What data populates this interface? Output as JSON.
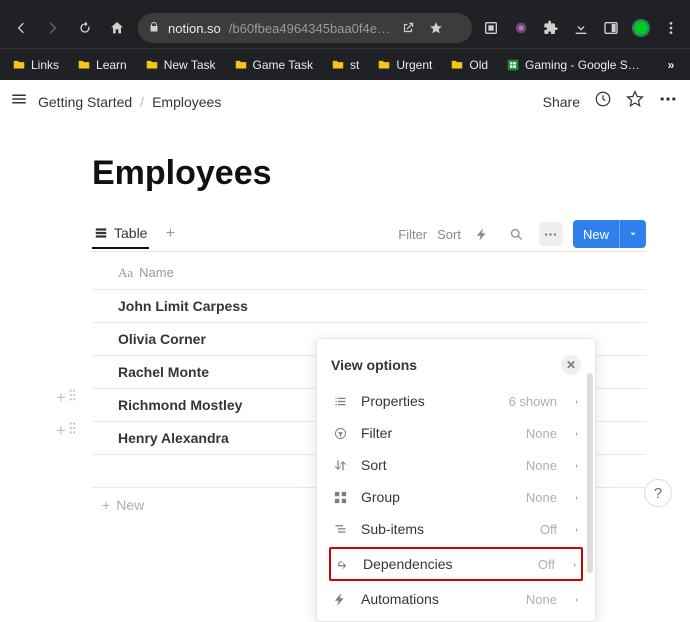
{
  "browser": {
    "url_domain": "notion.so",
    "url_path": "/b60fbea4964345baa0f4e…",
    "bookmarks": [
      "Links",
      "Learn",
      "New Task",
      "Game Task",
      "st",
      "Urgent",
      "Old"
    ],
    "bookmark_sheets": "Gaming - Google S…"
  },
  "topbar": {
    "breadcrumb_parent": "Getting Started",
    "breadcrumb_current": "Employees",
    "share": "Share"
  },
  "page": {
    "title": "Employees"
  },
  "views": {
    "tab_label": "Table",
    "filter": "Filter",
    "sort": "Sort",
    "new": "New"
  },
  "table": {
    "col_icon": "Aa",
    "col_name": "Name",
    "rows": [
      "John Limit Carpess",
      "Olivia Corner",
      "Rachel Monte",
      "Richmond Mostley",
      "Henry Alexandra"
    ],
    "add_new": "New"
  },
  "panel": {
    "title": "View options",
    "options": [
      {
        "icon": "list",
        "label": "Properties",
        "value": "6 shown"
      },
      {
        "icon": "filter",
        "label": "Filter",
        "value": "None"
      },
      {
        "icon": "sort",
        "label": "Sort",
        "value": "None"
      },
      {
        "icon": "group",
        "label": "Group",
        "value": "None"
      },
      {
        "icon": "subitems",
        "label": "Sub-items",
        "value": "Off"
      },
      {
        "icon": "deps",
        "label": "Dependencies",
        "value": "Off"
      },
      {
        "icon": "auto",
        "label": "Automations",
        "value": "None"
      }
    ]
  },
  "help": "?"
}
